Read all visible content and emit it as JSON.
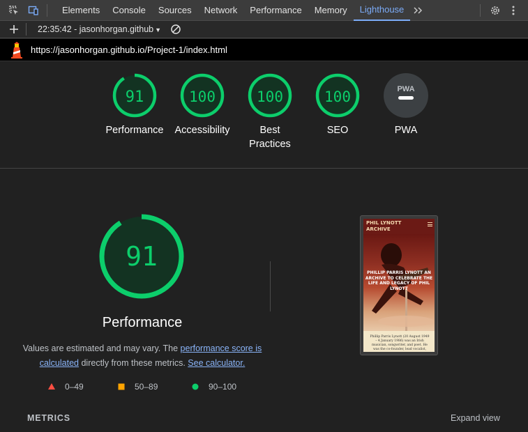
{
  "tabs": [
    {
      "label": "Elements"
    },
    {
      "label": "Console"
    },
    {
      "label": "Sources"
    },
    {
      "label": "Network"
    },
    {
      "label": "Performance"
    },
    {
      "label": "Memory"
    },
    {
      "label": "Lighthouse",
      "active": true
    }
  ],
  "toolbar": {
    "report_select": "22:35:42 - jasonhorgan.github"
  },
  "url": "https://jasonhorgan.github.io/Project-1/index.html",
  "categories": [
    {
      "label": "Performance",
      "score": "91",
      "value": 91
    },
    {
      "label": "Accessibility",
      "score": "100",
      "value": 100
    },
    {
      "label": "Best Practices",
      "score": "100",
      "value": 100
    },
    {
      "label": "SEO",
      "score": "100",
      "value": 100
    },
    {
      "label": "PWA",
      "score": "PWA",
      "value": null
    }
  ],
  "detail": {
    "score": "91",
    "score_value": 91,
    "title": "Performance",
    "desc_prefix": "Values are estimated and may vary. The ",
    "link_score": "performance score is calculated",
    "desc_mid": " directly from these metrics. ",
    "link_calc": "See calculator."
  },
  "legend": [
    {
      "label": "0–49",
      "color": "#ff4e42",
      "shape": "triangle"
    },
    {
      "label": "50–89",
      "color": "#ffa400",
      "shape": "square"
    },
    {
      "label": "90–100",
      "color": "#0cce6b",
      "shape": "circle"
    }
  ],
  "thumbnail": {
    "site_title": "PHIL LYNOTT ARCHIVE",
    "hero_text": "PHILLIP PARRIS LYNOTT AN ARCHIVE TO CELEBRATE THE LIFE AND LEGACY OF PHIL LYNOTT",
    "body_text": "Phillip Parris Lynott (20 August 1949 – 4 January 1986) was an Irish musician, songwriter, and poet. He was the co-founder, lead vocalist,"
  },
  "footer": {
    "metrics_label": "METRICS",
    "expand_label": "Expand view"
  },
  "colors": {
    "pass": "#0cce6b",
    "pass_bg": "#133322",
    "accent": "#7cacf8"
  }
}
